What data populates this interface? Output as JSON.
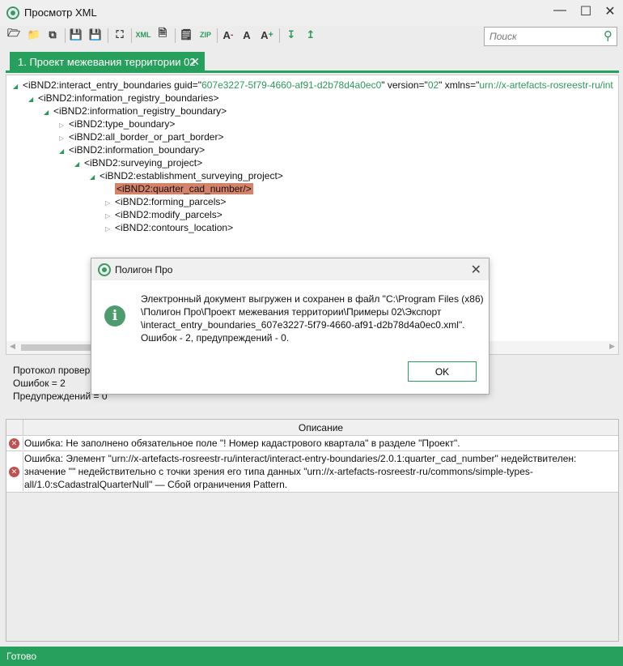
{
  "window": {
    "title": "Просмотр XML",
    "icon": "target-logo-icon",
    "controls": [
      "minimize",
      "maximize",
      "close"
    ]
  },
  "toolbar": {
    "icons": [
      "open-icon",
      "folder-icon",
      "copy-icon",
      "save-xml-icon",
      "save-as-icon",
      "fit-icon",
      "validate-xml-icon",
      "sign-icon",
      "notes-icon",
      "zip-icon",
      "font-decrease-icon",
      "font-reset-icon",
      "font-increase-icon",
      "expand-all-icon",
      "collapse-all-icon"
    ]
  },
  "search": {
    "placeholder": "Поиск",
    "value": ""
  },
  "tabs": [
    {
      "label": "1. Проект межевания территории 02"
    }
  ],
  "tree": {
    "root": {
      "tag": "<iBND2:interact_entry_boundaries guid=\"",
      "guid": "607e3227-5f79-4660-af91-d2b78d4a0ec0",
      "mid": "\" version=\"",
      "version": "02",
      "mid2": "\" xmlns=\"",
      "xmlns": "urn://x-artefacts-rosreestr-ru/int"
    },
    "nodes": [
      {
        "label": "<iBND2:information_registry_boundaries>",
        "expanded": true
      },
      {
        "label": "<iBND2:information_registry_boundary>",
        "expanded": true
      },
      {
        "label": "<iBND2:type_boundary>",
        "expanded": false
      },
      {
        "label": "<iBND2:all_border_or_part_border>",
        "expanded": false
      },
      {
        "label": "<iBND2:information_boundary>",
        "expanded": true
      },
      {
        "label": "<iBND2:surveying_project>",
        "expanded": true
      },
      {
        "label": "<iBND2:establishment_surveying_project>",
        "expanded": true
      },
      {
        "label": "<iBND2:quarter_cad_number/>",
        "selected": true
      },
      {
        "label": "<iBND2:forming_parcels>",
        "expanded": false
      },
      {
        "label": "<iBND2:modify_parcels>",
        "expanded": false
      },
      {
        "label": "<iBND2:contours_location>",
        "expanded": false
      }
    ]
  },
  "protocol": {
    "line1": "Протокол провер",
    "line2": "Ошибок = 2",
    "line3": "Предупреждений = 0"
  },
  "grid": {
    "header": "Описание",
    "rows": [
      {
        "type": "error",
        "text": "Ошибка: Не заполнено обязательное поле \"! Номер кадастрового квартала\" в разделе \"Проект\"."
      },
      {
        "type": "error",
        "text": "Ошибка: Элемент \"urn://x-artefacts-rosreestr-ru/interact/interact-entry-boundaries/2.0.1:quarter_cad_number\" недействителен: значение \"\" недействительно с точки зрения его типа данных \"urn://x-artefacts-rosreestr-ru/commons/simple-types-all/1.0:sCadastralQuarterNull\" — Сбой ограничения Pattern."
      }
    ]
  },
  "status": "Готово",
  "dialog": {
    "title": "Полигон Про",
    "icon": "info-icon",
    "line1": "Электронный документ выгружен и сохранен в файл \"C:\\Program Files (x86)",
    "line2": "\\Полигон Про\\Проект межевания территории\\Примеры 02\\Экспорт",
    "line3": "\\interact_entry_boundaries_607e3227-5f79-4660-af91-d2b78d4a0ec0.xml\".",
    "line4": "Ошибок - 2, предупреждений - 0.",
    "ok": "OK"
  },
  "colors": {
    "accent": "#27a05d",
    "selection": "#d4826a",
    "error": "#c0504d"
  }
}
